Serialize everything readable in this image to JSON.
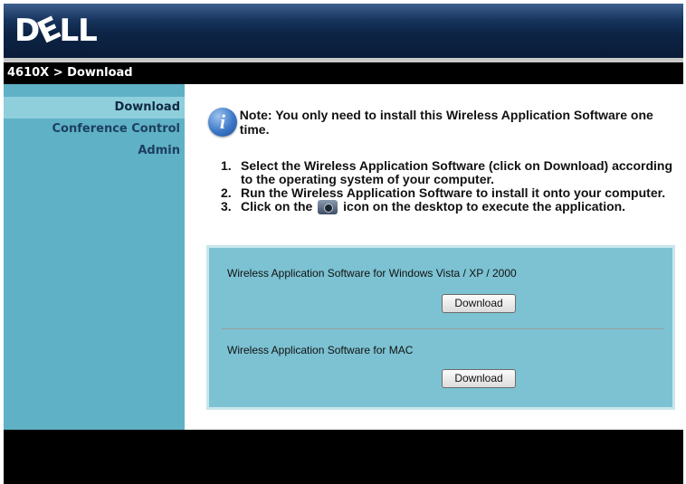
{
  "header": {
    "logo_text_d": "D",
    "logo_text_e": "E",
    "logo_text_ll": "LL",
    "logo_name": "dell-logo"
  },
  "breadcrumb": "4610X > Download",
  "sidebar": {
    "items": [
      {
        "label": "Download",
        "active": true
      },
      {
        "label": "Conference Control",
        "active": false
      },
      {
        "label": "Admin",
        "active": false
      }
    ]
  },
  "main": {
    "note": "Note: You only need to install this Wireless Application Software one time.",
    "info_icon_glyph": "i",
    "steps": [
      {
        "num": "1.",
        "text": "Select the Wireless Application Software (click on Download) according to the operating system of your computer."
      },
      {
        "num": "2.",
        "text": "Run the Wireless Application Software to install it onto your computer."
      },
      {
        "num": "3.",
        "text_before": "Click on the",
        "text_after": "icon on the desktop to execute the application.",
        "icon": "projector-camera-icon"
      }
    ],
    "downloads": [
      {
        "label": "Wireless Application Software for Windows Vista / XP / 2000",
        "button": "Download"
      },
      {
        "label": "Wireless Application Software for MAC",
        "button": "Download"
      }
    ]
  },
  "colors": {
    "sidebar": "#5fb1c5",
    "sidebar_active": "#8fcfdc",
    "panel": "#7cc2d2",
    "header": "#0d2446"
  }
}
